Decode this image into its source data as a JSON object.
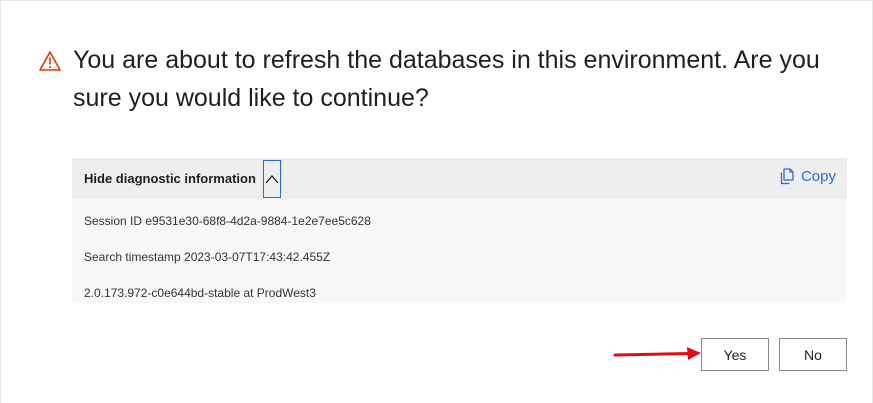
{
  "dialog": {
    "title": "You are about to refresh the databases in this environment. Are you sure you would like to continue?",
    "warning_icon": "warning-triangle-icon",
    "warning_color": "#d83b01"
  },
  "diagnostics": {
    "toggle_label": "Hide diagnostic information",
    "toggle_icon": "chevron-up-icon",
    "copy_label": "Copy",
    "copy_icon": "copy-icon",
    "lines": [
      "Session ID e9531e30-68f8-4d2a-9884-1e2e7ee5c628",
      "Search timestamp 2023-03-07T17:43:42.455Z",
      "2.0.173.972-c0e644bd-stable at ProdWest3"
    ]
  },
  "actions": {
    "yes_label": "Yes",
    "no_label": "No"
  },
  "annotation": {
    "arrow_icon": "red-arrow-icon",
    "arrow_color": "#e01010"
  },
  "colors": {
    "accent": "#2b6cd9",
    "panel_header": "#eeeeee",
    "panel_body": "#f8f8f8"
  }
}
